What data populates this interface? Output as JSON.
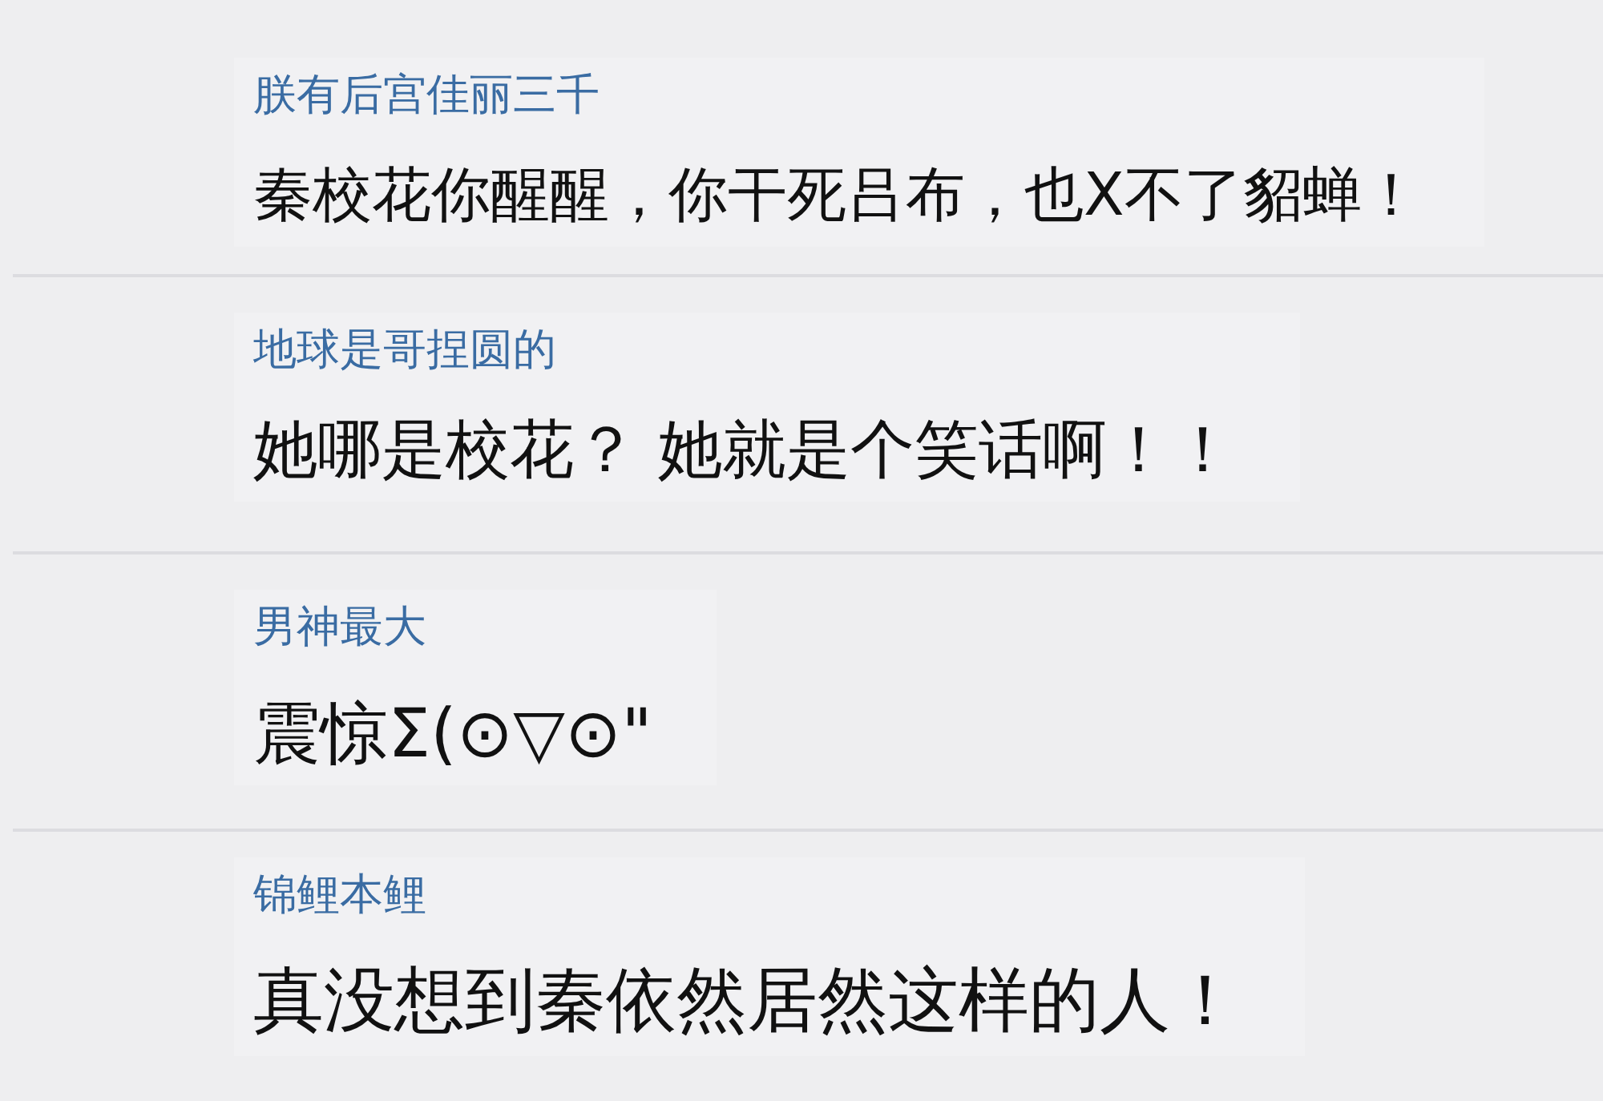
{
  "comments": [
    {
      "username": "朕有后宫佳丽三千",
      "text": "秦校花你醒醒，你干死吕布，也X不了貂蝉！"
    },
    {
      "username": "地球是哥捏圆的",
      "text": "她哪是校花？ 她就是个笑话啊！！"
    },
    {
      "username": "男神最大",
      "text": "震惊Σ(⊙▽⊙\""
    },
    {
      "username": "锦鲤本鲤",
      "text": "真没想到秦依然居然这样的人！"
    }
  ]
}
